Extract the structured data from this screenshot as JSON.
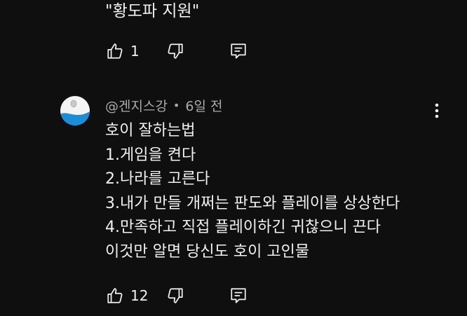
{
  "previous_comment": {
    "text_tail": "\"황도파 지원\"",
    "like_count": "1",
    "icons": {
      "like": "thumbs-up-icon",
      "dislike": "thumbs-down-icon",
      "reply": "reply-comment-icon"
    }
  },
  "comment": {
    "author": "@겐지스강",
    "separator": "•",
    "time": "6일 전",
    "lines": [
      "호이 잘하는법",
      "1.게임을 켠다",
      "2.나라를 고른다",
      "3.내가 만들 개쩌는 판도와 플레이를 상상한다",
      "4.만족하고 직접 플레이하긴 귀찮으니 끈다",
      "이것만 알면 당신도 호이 고인물"
    ],
    "like_count": "12",
    "icons": {
      "more": "vertical-ellipsis-icon",
      "like": "thumbs-up-icon",
      "dislike": "thumbs-down-icon",
      "reply": "reply-comment-icon"
    },
    "avatar_colors": {
      "top": "#f4f4f4",
      "wave": "#1a8fd6"
    }
  }
}
